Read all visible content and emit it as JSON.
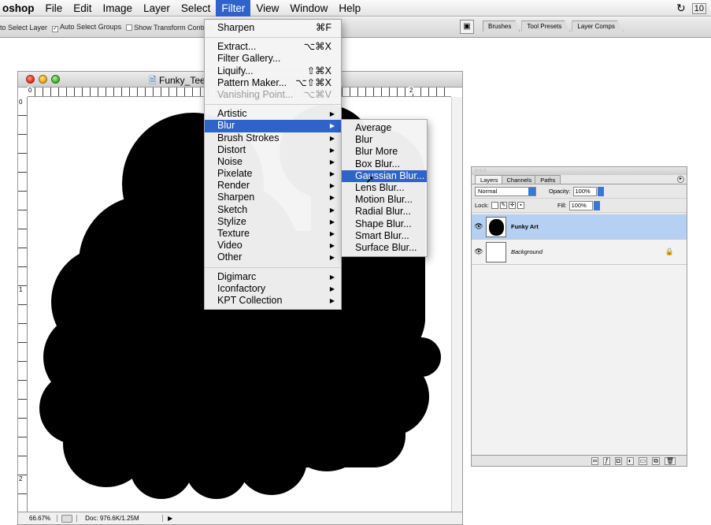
{
  "menubar": {
    "app": "oshop",
    "items": [
      "File",
      "Edit",
      "Image",
      "Layer",
      "Select",
      "Filter",
      "View",
      "Window",
      "Help"
    ],
    "active": "Filter",
    "clock": "10"
  },
  "options_bar": {
    "auto_select_layer": "to Select Layer",
    "auto_select_groups": "Auto Select Groups",
    "show_transform": "Show Transform Controls",
    "palette_tabs": [
      "Brushes",
      "Tool Presets",
      "Layer Comps"
    ]
  },
  "document": {
    "title": "Funky_Tee_",
    "zoom": "66.67%",
    "doc_size": "Doc: 976.6K/1.25M",
    "ruler_top": [
      "0",
      "2"
    ],
    "ruler_left": [
      "0",
      "1",
      "2"
    ]
  },
  "filter_menu": {
    "groups": [
      [
        {
          "label": "Sharpen",
          "shortcut": "⌘F"
        }
      ],
      [
        {
          "label": "Extract...",
          "shortcut": "⌥⌘X"
        },
        {
          "label": "Filter Gallery...",
          "shortcut": ""
        },
        {
          "label": "Liquify...",
          "shortcut": "⇧⌘X"
        },
        {
          "label": "Pattern Maker...",
          "shortcut": "⌥⇧⌘X"
        },
        {
          "label": "Vanishing Point...",
          "shortcut": "⌥⌘V",
          "disabled": true
        }
      ],
      [
        {
          "label": "Artistic",
          "sub": true
        },
        {
          "label": "Blur",
          "sub": true,
          "selected": true
        },
        {
          "label": "Brush Strokes",
          "sub": true
        },
        {
          "label": "Distort",
          "sub": true
        },
        {
          "label": "Noise",
          "sub": true
        },
        {
          "label": "Pixelate",
          "sub": true
        },
        {
          "label": "Render",
          "sub": true
        },
        {
          "label": "Sharpen",
          "sub": true
        },
        {
          "label": "Sketch",
          "sub": true
        },
        {
          "label": "Stylize",
          "sub": true
        },
        {
          "label": "Texture",
          "sub": true
        },
        {
          "label": "Video",
          "sub": true
        },
        {
          "label": "Other",
          "sub": true
        }
      ],
      [
        {
          "label": "Digimarc",
          "sub": true
        },
        {
          "label": "Iconfactory",
          "sub": true
        },
        {
          "label": "KPT Collection",
          "sub": true
        }
      ]
    ]
  },
  "blur_menu": {
    "items": [
      "Average",
      "Blur",
      "Blur More",
      "Box Blur...",
      "Gaussian Blur...",
      "Lens Blur...",
      "Motion Blur...",
      "Radial Blur...",
      "Shape Blur...",
      "Smart Blur...",
      "Surface Blur..."
    ],
    "selected_index": 4
  },
  "layers_panel": {
    "tabs": [
      "Layers",
      "Channels",
      "Paths"
    ],
    "blend_mode": "Normal",
    "opacity_label": "Opacity:",
    "opacity": "100%",
    "lock_label": "Lock:",
    "fill_label": "Fill:",
    "fill": "100%",
    "layers": [
      {
        "name": "Funky Art",
        "active": true
      },
      {
        "name": "Background",
        "locked": true
      }
    ]
  },
  "colors": {
    "menu_highlight": "#2f63c9",
    "layer_selected": "#b5d0f3"
  }
}
